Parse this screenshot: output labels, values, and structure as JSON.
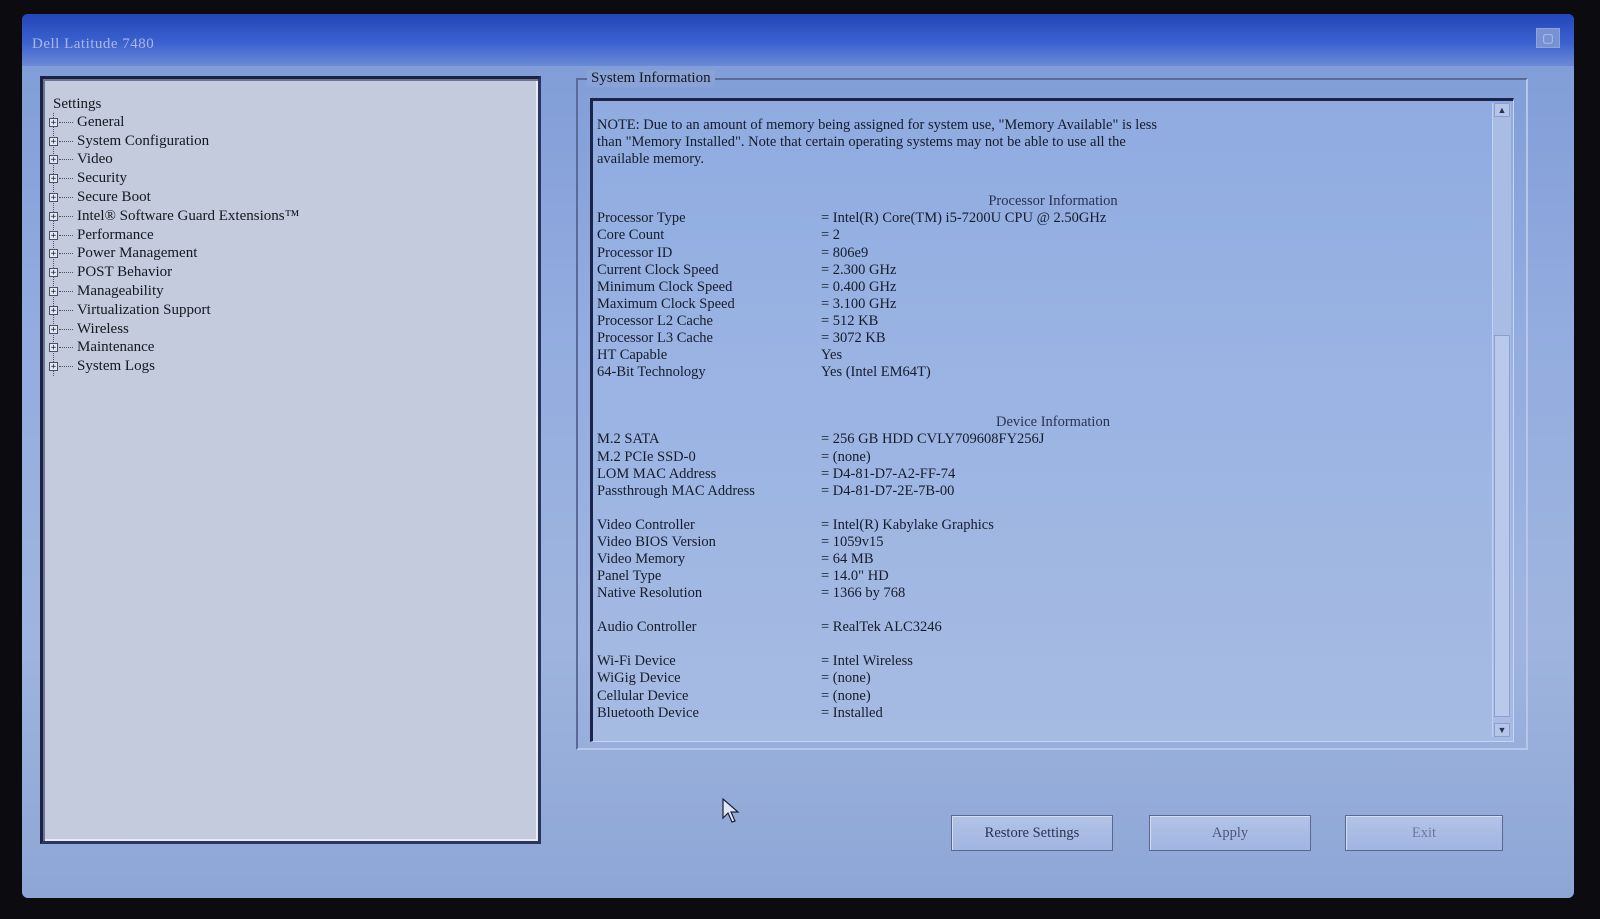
{
  "window": {
    "title": "Dell Latitude 7480",
    "close_glyph": "▢"
  },
  "tree": {
    "root": "Settings",
    "expander_glyph": "+",
    "items": [
      "General",
      "System Configuration",
      "Video",
      "Security",
      "Secure Boot",
      "Intel® Software Guard Extensions™",
      "Performance",
      "Power Management",
      "POST Behavior",
      "Manageability",
      "Virtualization Support",
      "Wireless",
      "Maintenance",
      "System Logs"
    ]
  },
  "system_info": {
    "group_title": "System Information",
    "note": "NOTE: Due to an amount of memory being assigned for system use, \"Memory Available\" is less\nthan \"Memory Installed\". Note that certain operating systems may not be able to use all the\navailable memory.",
    "processor_title": "Processor Information",
    "processor": [
      {
        "k": "Processor Type",
        "v": "= Intel(R) Core(TM) i5-7200U CPU @ 2.50GHz"
      },
      {
        "k": "Core Count",
        "v": "= 2"
      },
      {
        "k": "Processor ID",
        "v": "= 806e9"
      },
      {
        "k": "Current Clock Speed",
        "v": "= 2.300 GHz"
      },
      {
        "k": "Minimum Clock Speed",
        "v": "= 0.400 GHz"
      },
      {
        "k": "Maximum Clock Speed",
        "v": "= 3.100 GHz"
      },
      {
        "k": "Processor L2 Cache",
        "v": "= 512 KB"
      },
      {
        "k": "Processor L3 Cache",
        "v": "= 3072 KB"
      },
      {
        "k": "HT Capable",
        "v": "Yes"
      },
      {
        "k": "64-Bit Technology",
        "v": "Yes (Intel EM64T)"
      }
    ],
    "device_title": "Device Information",
    "storage": [
      {
        "k": "M.2 SATA",
        "v": "= 256 GB HDD CVLY709608FY256J"
      },
      {
        "k": "M.2 PCIe SSD-0",
        "v": "= (none)"
      },
      {
        "k": "LOM MAC Address",
        "v": "= D4-81-D7-A2-FF-74"
      },
      {
        "k": "Passthrough MAC Address",
        "v": "= D4-81-D7-2E-7B-00"
      }
    ],
    "video": [
      {
        "k": "Video Controller",
        "v": "= Intel(R) Kabylake Graphics"
      },
      {
        "k": "Video BIOS Version",
        "v": "= 1059v15"
      },
      {
        "k": "Video Memory",
        "v": "= 64 MB"
      },
      {
        "k": "Panel Type",
        "v": "= 14.0\" HD"
      },
      {
        "k": "Native Resolution",
        "v": "= 1366 by 768"
      }
    ],
    "audio": [
      {
        "k": "Audio Controller",
        "v": "= RealTek ALC3246"
      }
    ],
    "wireless": [
      {
        "k": "Wi-Fi Device",
        "v": "= Intel Wireless"
      },
      {
        "k": "WiGig Device",
        "v": "= (none)"
      },
      {
        "k": "Cellular Device",
        "v": "= (none)"
      },
      {
        "k": "Bluetooth Device",
        "v": "= Installed"
      }
    ],
    "scroll_up_glyph": "▲",
    "scroll_down_glyph": "▼"
  },
  "buttons": {
    "restore": "Restore Settings",
    "apply": "Apply",
    "exit": "Exit"
  },
  "colors": {
    "title_bar": "#2346b8",
    "background": "#93acdf",
    "tree_background": "#c3cbdc"
  }
}
